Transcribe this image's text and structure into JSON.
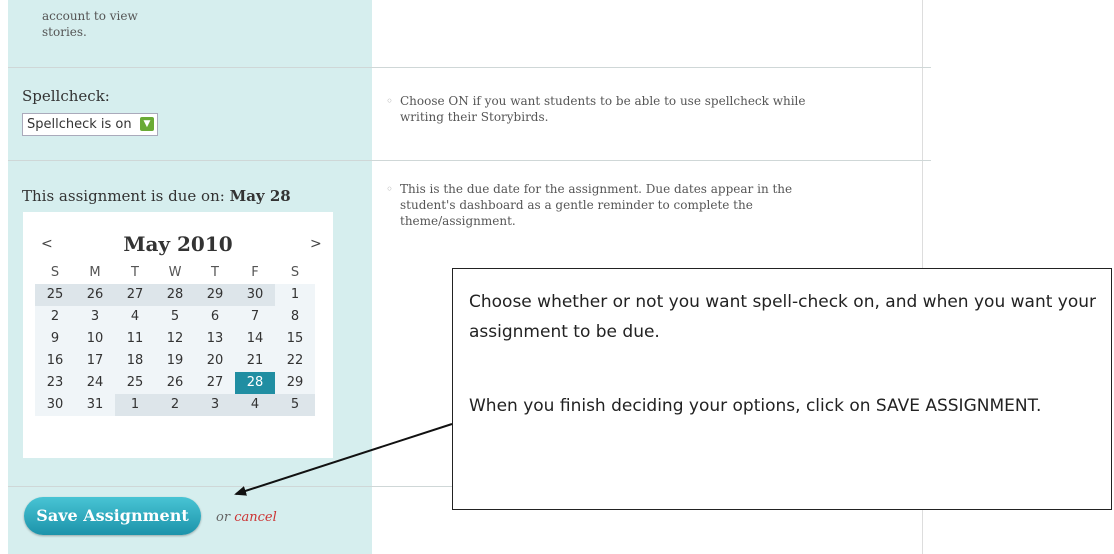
{
  "account_note": [
    "account to view",
    "stories."
  ],
  "spellcheck": {
    "label": "Spellcheck:",
    "value": "Spellcheck is on",
    "hint": [
      "Choose ON if you want students to be able to use spellcheck while",
      "writing their Storybirds."
    ]
  },
  "due": {
    "label_prefix": "This assignment is due on:",
    "label_date": "May 28",
    "hint": [
      "This is the due date for the assignment. Due dates appear in the",
      "student's dashboard as a gentle reminder to complete the",
      "theme/assignment."
    ]
  },
  "calendar": {
    "prev": "<",
    "next": ">",
    "title": "May 2010",
    "days_of_week": [
      "S",
      "M",
      "T",
      "W",
      "T",
      "F",
      "S"
    ],
    "weeks": [
      [
        "25",
        "26",
        "27",
        "28",
        "29",
        "30",
        "1"
      ],
      [
        "2",
        "3",
        "4",
        "5",
        "6",
        "7",
        "8"
      ],
      [
        "9",
        "10",
        "11",
        "12",
        "13",
        "14",
        "15"
      ],
      [
        "16",
        "17",
        "18",
        "19",
        "20",
        "21",
        "22"
      ],
      [
        "23",
        "24",
        "25",
        "26",
        "27",
        "28",
        "29"
      ],
      [
        "30",
        "31",
        "1",
        "2",
        "3",
        "4",
        "5"
      ]
    ],
    "selected_day": "28"
  },
  "actions": {
    "save_label": "Save Assignment",
    "or_text": "or",
    "cancel_label": "cancel"
  },
  "callout": {
    "p1": "Choose whether or not you want spell-check on, and when you want your assignment to be due.",
    "p2": "When you finish deciding your options, click on SAVE ASSIGNMENT."
  }
}
